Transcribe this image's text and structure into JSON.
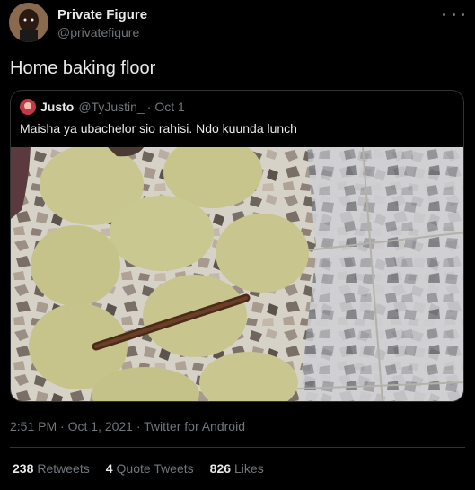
{
  "tweet": {
    "author_name": "Private Figure",
    "author_handle": "@privatefigure_",
    "text": "Home baking floor",
    "timestamp": "2:51 PM · Oct 1, 2021 · Twitter for Android"
  },
  "quoted": {
    "name": "Justo",
    "handle": "@TyJustin_",
    "separator": "·",
    "date": "Oct 1",
    "text": "Maisha ya ubachelor sio rahisi. Ndo kuunda lunch"
  },
  "stats": [
    {
      "count": "238",
      "label": "Retweets"
    },
    {
      "count": "4",
      "label": "Quote Tweets"
    },
    {
      "count": "826",
      "label": "Likes"
    }
  ],
  "icons": [
    "more-icon"
  ]
}
